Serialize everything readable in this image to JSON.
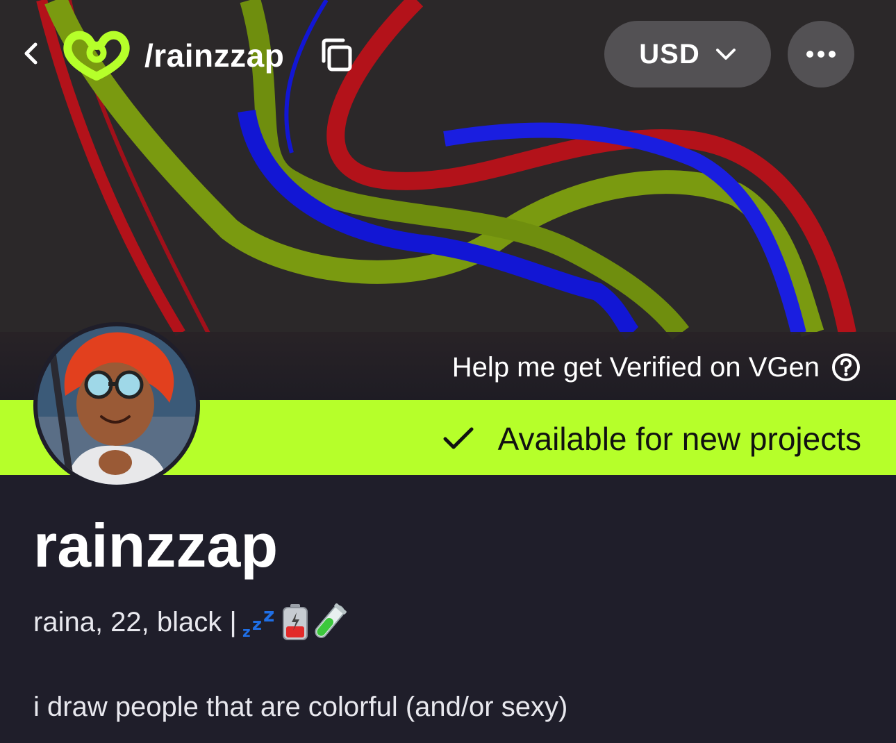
{
  "header": {
    "handle": "/rainzzap",
    "currency": "USD"
  },
  "banner": {
    "verify_text": "Help me get Verified on VGen"
  },
  "status": {
    "text": "Available for new projects"
  },
  "profile": {
    "name": "rainzzap",
    "bio_line1": "raina, 22, black |",
    "bio_line2": "i draw people that are colorful (and/or sexy)"
  },
  "icons": [
    "back-chevron-icon",
    "vgen-logo-icon",
    "copy-icon",
    "chevron-down-icon",
    "more-dots-icon",
    "help-circle-icon",
    "checkmark-icon",
    "zzz-emoji-icon",
    "battery-emoji-icon",
    "test-tube-emoji-icon"
  ],
  "colors": {
    "accent": "#b6ff2a",
    "page_bg": "#1f1e2a",
    "banner_bg": "#2a2828",
    "stroke_red": "#b3121a",
    "stroke_green": "#7a9a10",
    "stroke_blue": "#1216d4"
  }
}
